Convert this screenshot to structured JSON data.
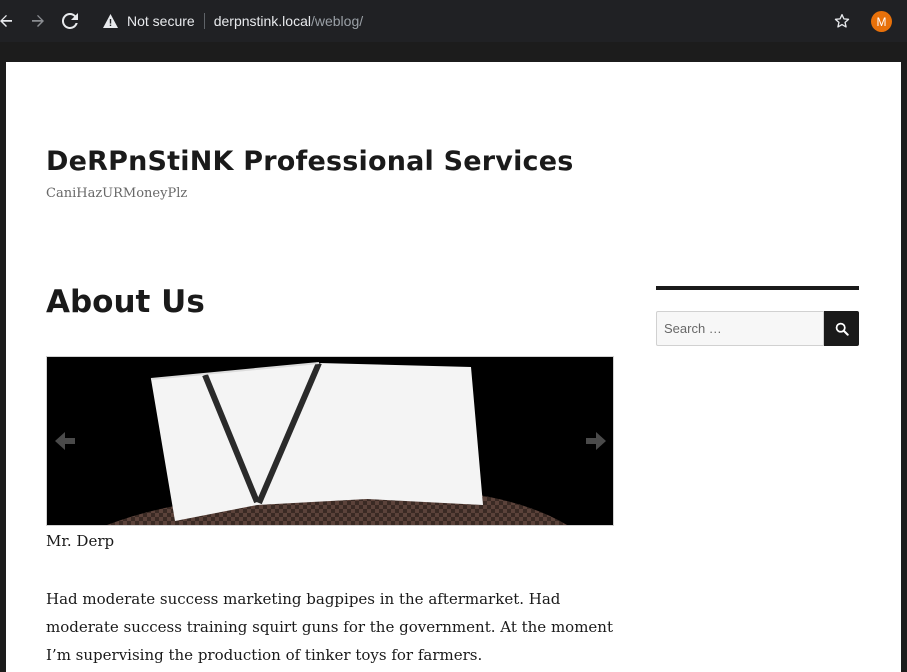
{
  "browser": {
    "security_label": "Not secure",
    "url_host": "derpnstink.local",
    "url_path": "/weblog/",
    "profile_initial": "M",
    "profile_color": "#e8710a",
    "icons": [
      "back-icon",
      "forward-icon",
      "reload-icon",
      "warning-icon",
      "star-icon"
    ]
  },
  "site": {
    "title": "DeRPnStiNK Professional Services",
    "description": "CaniHazURMoneyPlz"
  },
  "page": {
    "title": "About Us",
    "slider": {
      "caption": "Mr. Derp",
      "prev_icon": "arrow-left-icon",
      "next_icon": "arrow-right-icon"
    },
    "body_text": "Had moderate success marketing bagpipes in the aftermarket. Had moderate success training squirt guns for the government. At the moment I’m supervising the production of tinker toys for farmers."
  },
  "sidebar": {
    "search": {
      "placeholder": "Search …",
      "icon": "search-icon"
    }
  }
}
